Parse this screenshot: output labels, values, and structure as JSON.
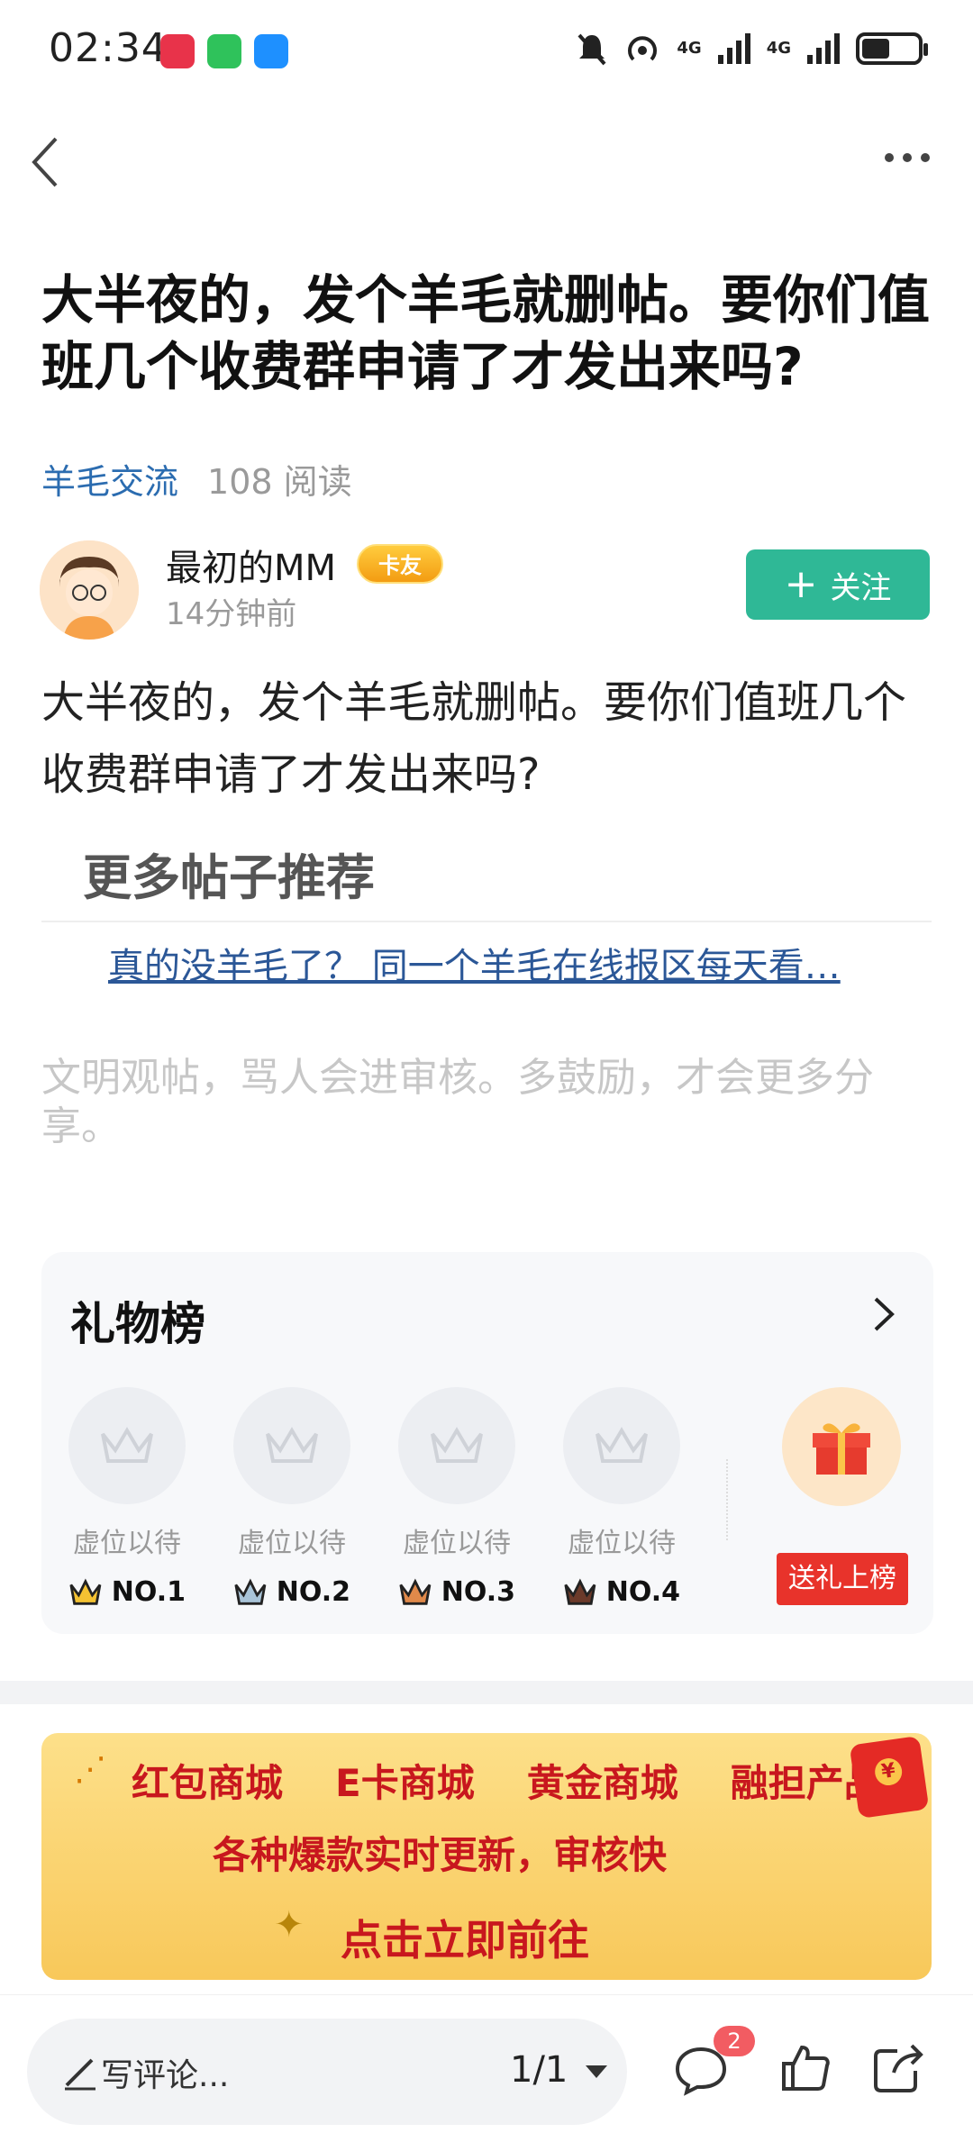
{
  "status_bar": {
    "time": "02:34",
    "net1": "4G",
    "net2": "4G",
    "notif_icons": [
      "huawei-store-icon",
      "wechat-icon",
      "message-icon"
    ]
  },
  "post": {
    "title": "大半夜的，发个羊毛就删帖。要你们值班几个收费群申请了才发出来吗?",
    "category": "羊毛交流",
    "reads": "108 阅读",
    "body": "大半夜的，发个羊毛就删帖。要你们值班几个收费群申请了才发出来吗?"
  },
  "author": {
    "name": "最初的MM",
    "badge": "卡友",
    "time_ago": "14分钟前",
    "follow_label": "关注"
  },
  "more_posts": {
    "header": "更多帖子推荐",
    "items": [
      "真的没羊毛了？ 同一个羊毛在线报区每天看…"
    ]
  },
  "rules_text": "文明观帖，骂人会进审核。多鼓励，才会更多分享。",
  "gift_board": {
    "title": "礼物榜",
    "slots": [
      {
        "label": "虚位以待",
        "rank": "NO.1",
        "crown_color": "#f4c232"
      },
      {
        "label": "虚位以待",
        "rank": "NO.2",
        "crown_color": "#a9c4d8"
      },
      {
        "label": "虚位以待",
        "rank": "NO.3",
        "crown_color": "#e0894a"
      },
      {
        "label": "虚位以待",
        "rank": "NO.4",
        "crown_color": "#6b3a2a"
      }
    ],
    "send_label": "送礼上榜"
  },
  "banner": {
    "row1": [
      "红包商城",
      "E卡商城",
      "黄金商城",
      "融担产品"
    ],
    "row2": "各种爆款实时更新，审核快",
    "row3": "点击立即前往"
  },
  "bottom_bar": {
    "comment_placeholder": "写评论...",
    "page_indicator": "1/1",
    "comment_count": "2"
  },
  "colors": {
    "accent_green": "#2fb896",
    "link_blue": "#2b6cb0",
    "red": "#e8332b"
  }
}
